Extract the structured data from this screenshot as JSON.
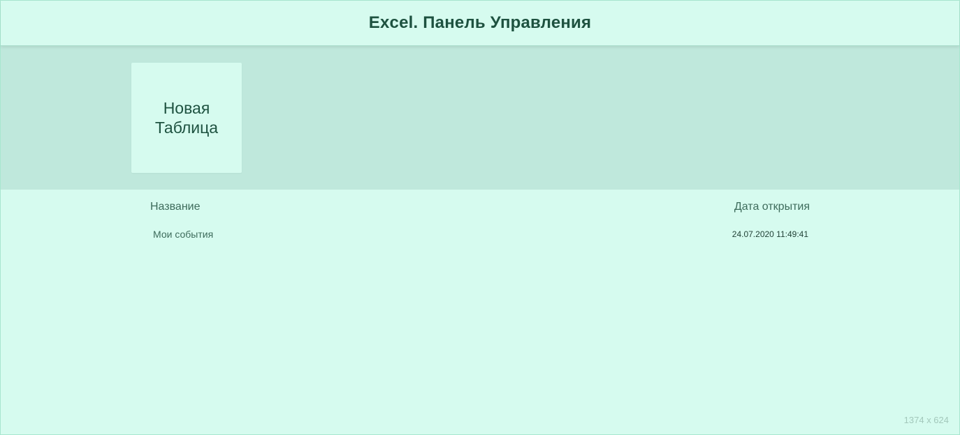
{
  "header": {
    "title": "Excel. Панель Управления"
  },
  "new_table": {
    "label": "Новая\nТаблица"
  },
  "list": {
    "columns": {
      "name": "Название",
      "date": "Дата открытия"
    },
    "rows": [
      {
        "name": "Мои события",
        "date": "24.07.2020 11:49:41"
      }
    ]
  },
  "watermark": "1374 x 624",
  "colors": {
    "background": "#d6fbef",
    "band": "#bfe8dc",
    "title_text": "#1e5240",
    "muted_text": "#3d6b5b"
  }
}
